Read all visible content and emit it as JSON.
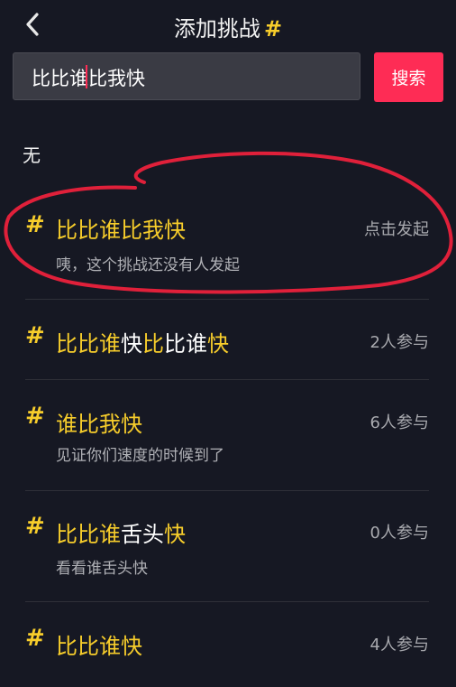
{
  "header": {
    "title": "添加挑战",
    "title_hash": "#"
  },
  "search": {
    "value": "比比谁比我快",
    "button_label": "搜索"
  },
  "status": {
    "none_label": "无"
  },
  "items": [
    {
      "hash": "#",
      "name_parts": [
        "比比谁比我快"
      ],
      "count": "点击发起",
      "description": "咦，这个挑战还没有人发起",
      "highlighted": true
    },
    {
      "hash": "#",
      "name_parts": [
        "比比谁",
        "快",
        "比",
        "比谁",
        "快"
      ],
      "count": "2人参与",
      "description": ""
    },
    {
      "hash": "#",
      "name_parts": [
        "谁比我快"
      ],
      "count": "6人参与",
      "description": "见证你们速度的时候到了"
    },
    {
      "hash": "#",
      "name_parts": [
        "比比谁",
        "舌头",
        "快"
      ],
      "count": "0人参与",
      "description": "看看谁舌头快"
    },
    {
      "hash": "#",
      "name_parts": [
        "比比谁快"
      ],
      "count": "4人参与",
      "description": ""
    }
  ],
  "colors": {
    "background": "#161823",
    "accent": "#fe2c55",
    "highlight_text": "#f7cd2b",
    "annotation_circle": "#e0203a"
  }
}
